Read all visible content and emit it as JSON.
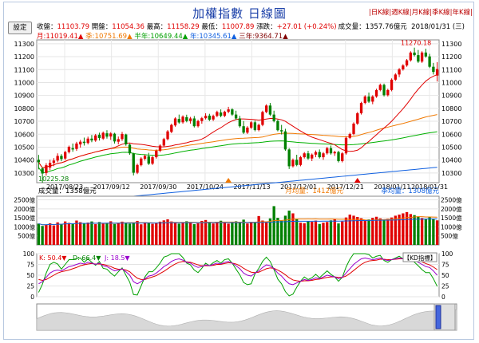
{
  "title": "加權指數  日線圖",
  "nav": {
    "sep": "|",
    "day": "日K線",
    "week": "週K線",
    "month": "月K線",
    "quarter": "季K線",
    "year": "年K線"
  },
  "settings_label": "設定",
  "info": {
    "close_label": "收盤：",
    "close": "11103.79",
    "open_label": "開盤：",
    "open": "11054.36",
    "high_label": "最高：",
    "high": "11158.29",
    "low_label": "最低：",
    "low": "11007.89",
    "chg_label": "漲跌：",
    "chg": "+27.01 (+0.24%)",
    "date": "2018/01/31 (三)",
    "turnover": "成交量：1357.76億元"
  },
  "ma": {
    "m": "月:11019.41▲",
    "q": "季:10751.69▲",
    "h": "半年:10649.44▲",
    "y": "年:10345.61▲",
    "y3": "三年:9364.71▲"
  },
  "colors": {
    "up": "#e00000",
    "down": "#008000",
    "ma_month": "#e00000",
    "ma_quarter": "#f07800",
    "ma_halfyear": "#00b000",
    "ma_year": "#1060e0",
    "k_line": "#9900cc",
    "d_line": "#e00000",
    "j_line": "#00a000"
  },
  "price_panel": {
    "max_label": "11270.18",
    "min_label": "10225.28",
    "y_ticks": [
      "11300",
      "11200",
      "11100",
      "11000",
      "10900",
      "10800",
      "10700",
      "10600",
      "10500",
      "10400",
      "10300"
    ],
    "x_ticks": [
      "2017/08/23",
      "2017/09/12",
      "2017/09/30",
      "2017/10/24",
      "2017/11/13",
      "2017/12/01",
      "2017/12/21",
      "2018/01/11",
      "2018/01/31"
    ]
  },
  "volume_panel": {
    "label": "成交量：1358億元",
    "month_avg": "月均量：1412億元",
    "quarter_avg": "季均量：1308億元",
    "y_ticks": [
      "2500億",
      "2000億",
      "1500億",
      "1000億",
      "500億"
    ]
  },
  "kd_panel": {
    "k": "K: 50.4▼",
    "d": "D: 66.4▼",
    "j": "J: 18.5▼",
    "label": "KD指標",
    "y_ticks": [
      "100",
      "75",
      "50",
      "25",
      "0"
    ]
  },
  "chart_data": {
    "type": "candlestick",
    "candles": [
      [
        10402,
        10440,
        10328,
        10383
      ],
      [
        10335,
        10345,
        10225,
        10296
      ],
      [
        10300,
        10376,
        10280,
        10360
      ],
      [
        10342,
        10402,
        10322,
        10378
      ],
      [
        10378,
        10415,
        10352,
        10396
      ],
      [
        10396,
        10452,
        10383,
        10432
      ],
      [
        10432,
        10446,
        10391,
        10408
      ],
      [
        10412,
        10471,
        10401,
        10462
      ],
      [
        10462,
        10512,
        10451,
        10502
      ],
      [
        10492,
        10528,
        10464,
        10482
      ],
      [
        10486,
        10541,
        10471,
        10528
      ],
      [
        10521,
        10556,
        10496,
        10542
      ],
      [
        10542,
        10574,
        10512,
        10532
      ],
      [
        10532,
        10581,
        10521,
        10566
      ],
      [
        10566,
        10594,
        10538,
        10552
      ],
      [
        10551,
        10602,
        10541,
        10591
      ],
      [
        10596,
        10612,
        10551,
        10571
      ],
      [
        10566,
        10621,
        10556,
        10611
      ],
      [
        10607,
        10631,
        10566,
        10581
      ],
      [
        10582,
        10616,
        10556,
        10606
      ],
      [
        10604,
        10611,
        10528,
        10544
      ],
      [
        10542,
        10582,
        10521,
        10562
      ],
      [
        10562,
        10618,
        10548,
        10602
      ],
      [
        10598,
        10604,
        10511,
        10522
      ],
      [
        10520,
        10526,
        10441,
        10452
      ],
      [
        10450,
        10456,
        10281,
        10302
      ],
      [
        10302,
        10372,
        10291,
        10362
      ],
      [
        10360,
        10422,
        10351,
        10412
      ],
      [
        10410,
        10442,
        10396,
        10432
      ],
      [
        10428,
        10456,
        10362,
        10372
      ],
      [
        10372,
        10432,
        10362,
        10422
      ],
      [
        10422,
        10482,
        10411,
        10472
      ],
      [
        10472,
        10522,
        10461,
        10512
      ],
      [
        10512,
        10572,
        10502,
        10562
      ],
      [
        10562,
        10632,
        10552,
        10622
      ],
      [
        10618,
        10682,
        10608,
        10672
      ],
      [
        10668,
        10731,
        10658,
        10722
      ],
      [
        10718,
        10752,
        10681,
        10691
      ],
      [
        10692,
        10746,
        10681,
        10736
      ],
      [
        10732,
        10751,
        10692,
        10702
      ],
      [
        10702,
        10734,
        10682,
        10722
      ],
      [
        10722,
        10741,
        10652,
        10662
      ],
      [
        10662,
        10712,
        10652,
        10702
      ],
      [
        10702,
        10734,
        10681,
        10724
      ],
      [
        10724,
        10762,
        10714,
        10742
      ],
      [
        10744,
        10758,
        10702,
        10712
      ],
      [
        10714,
        10752,
        10702,
        10742
      ],
      [
        10742,
        10782,
        10732,
        10772
      ],
      [
        10768,
        10792,
        10731,
        10742
      ],
      [
        10742,
        10782,
        10732,
        10774
      ],
      [
        10774,
        10812,
        10762,
        10792
      ],
      [
        10792,
        10801,
        10742,
        10752
      ],
      [
        10752,
        10782,
        10712,
        10722
      ],
      [
        10722,
        10742,
        10651,
        10662
      ],
      [
        10662,
        10702,
        10602,
        10612
      ],
      [
        10612,
        10662,
        10602,
        10651
      ],
      [
        10651,
        10702,
        10641,
        10692
      ],
      [
        10692,
        10706,
        10622,
        10632
      ],
      [
        10632,
        10682,
        10622,
        10672
      ],
      [
        10672,
        10782,
        10662,
        10772
      ],
      [
        10772,
        10832,
        10762,
        10822
      ],
      [
        10822,
        10842,
        10742,
        10752
      ],
      [
        10752,
        10782,
        10692,
        10702
      ],
      [
        10702,
        10712,
        10622,
        10631
      ],
      [
        10631,
        10672,
        10598,
        10622
      ],
      [
        10622,
        10642,
        10472,
        10482
      ],
      [
        10482,
        10492,
        10331,
        10352
      ],
      [
        10352,
        10412,
        10342,
        10402
      ],
      [
        10402,
        10441,
        10352,
        10362
      ],
      [
        10362,
        10432,
        10352,
        10422
      ],
      [
        10422,
        10462,
        10412,
        10452
      ],
      [
        10452,
        10472,
        10402,
        10412
      ],
      [
        10412,
        10451,
        10392,
        10442
      ],
      [
        10442,
        10474,
        10422,
        10462
      ],
      [
        10462,
        10482,
        10412,
        10422
      ],
      [
        10422,
        10462,
        10402,
        10452
      ],
      [
        10452,
        10502,
        10442,
        10492
      ],
      [
        10492,
        10512,
        10442,
        10452
      ],
      [
        10452,
        10472,
        10432,
        10462
      ],
      [
        10462,
        10472,
        10382,
        10392
      ],
      [
        10392,
        10462,
        10382,
        10452
      ],
      [
        10452,
        10582,
        10442,
        10572
      ],
      [
        10572,
        10612,
        10562,
        10602
      ],
      [
        10602,
        10692,
        10592,
        10682
      ],
      [
        10682,
        10772,
        10672,
        10762
      ],
      [
        10762,
        10851,
        10752,
        10842
      ],
      [
        10842,
        10902,
        10832,
        10892
      ],
      [
        10892,
        10922,
        10842,
        10852
      ],
      [
        10852,
        10902,
        10832,
        10892
      ],
      [
        10892,
        10952,
        10882,
        10942
      ],
      [
        10942,
        10992,
        10932,
        10982
      ],
      [
        10982,
        10992,
        10892,
        10902
      ],
      [
        10902,
        10952,
        10892,
        10942
      ],
      [
        10942,
        11032,
        10932,
        11022
      ],
      [
        11022,
        11072,
        11012,
        11062
      ],
      [
        11062,
        11112,
        11042,
        11102
      ],
      [
        11102,
        11142,
        11092,
        11132
      ],
      [
        11132,
        11182,
        11122,
        11172
      ],
      [
        11172,
        11242,
        11162,
        11232
      ],
      [
        11232,
        11270,
        11202,
        11212
      ],
      [
        11212,
        11252,
        11152,
        11162
      ],
      [
        11162,
        11242,
        11152,
        11232
      ],
      [
        11232,
        11262,
        11192,
        11202
      ],
      [
        11202,
        11222,
        11112,
        11122
      ],
      [
        11122,
        11152,
        11062,
        11082
      ],
      [
        11054,
        11158,
        11008,
        11104
      ]
    ],
    "volume": [
      1180,
      1050,
      1120,
      1200,
      1080,
      1250,
      1150,
      1300,
      1220,
      1180,
      1350,
      1260,
      1180,
      1240,
      1300,
      1150,
      1270,
      1180,
      1220,
      1310,
      1160,
      1230,
      1290,
      1210,
      1180,
      1250,
      1330,
      1140,
      1260,
      1200,
      1170,
      1230,
      1290,
      1360,
      1420,
      1300,
      1250,
      1180,
      1220,
      1310,
      1270,
      1150,
      1200,
      1330,
      1380,
      1250,
      1190,
      1260,
      1340,
      1220,
      1180,
      1270,
      1310,
      1250,
      1400,
      1190,
      1280,
      1230,
      1600,
      1350,
      1290,
      1470,
      2150,
      1500,
      1340,
      1620,
      1900,
      1750,
      1450,
      1230,
      1200,
      1320,
      1280,
      1350,
      1160,
      1230,
      1270,
      1360,
      1420,
      1190,
      1300,
      1520,
      1680,
      1620,
      1550,
      1480,
      1350,
      1410,
      1500,
      1560,
      1470,
      1390,
      1450,
      1520,
      1620,
      1680,
      1750,
      1820,
      1710,
      1650,
      1580,
      1490,
      1430,
      1550,
      1420,
      1360
    ],
    "kd_k": [
      30,
      35,
      45,
      55,
      60,
      62,
      60,
      65,
      70,
      72,
      75,
      78,
      76,
      80,
      78,
      75,
      78,
      72,
      70,
      65,
      60,
      62,
      65,
      58,
      50,
      35,
      30,
      35,
      42,
      48,
      50,
      55,
      62,
      70,
      75,
      82,
      86,
      88,
      85,
      80,
      78,
      72,
      68,
      70,
      74,
      72,
      75,
      78,
      76,
      80,
      82,
      78,
      72,
      65,
      55,
      50,
      48,
      55,
      60,
      68,
      74,
      72,
      65,
      55,
      48,
      38,
      30,
      28,
      32,
      36,
      40,
      38,
      40,
      44,
      42,
      46,
      50,
      48,
      46,
      42,
      45,
      55,
      65,
      75,
      82,
      88,
      90,
      88,
      86,
      88,
      90,
      86,
      84,
      86,
      88,
      90,
      88,
      86,
      88,
      84,
      80,
      75,
      70,
      68,
      60,
      50
    ],
    "kd_d": [
      40,
      38,
      40,
      45,
      50,
      55,
      58,
      60,
      62,
      65,
      68,
      72,
      74,
      76,
      77,
      76,
      76,
      75,
      73,
      70,
      66,
      64,
      64,
      62,
      58,
      50,
      43,
      40,
      40,
      43,
      46,
      49,
      54,
      59,
      65,
      71,
      76,
      80,
      82,
      81,
      80,
      77,
      74,
      72,
      72,
      72,
      73,
      75,
      75,
      77,
      79,
      78,
      76,
      72,
      66,
      61,
      57,
      56,
      57,
      61,
      65,
      67,
      66,
      62,
      57,
      51,
      44,
      39,
      37,
      36,
      37,
      37,
      38,
      40,
      41,
      43,
      45,
      46,
      46,
      45,
      45,
      48,
      54,
      61,
      68,
      75,
      80,
      83,
      84,
      85,
      87,
      87,
      86,
      86,
      87,
      88,
      88,
      87,
      87,
      86,
      84,
      81,
      77,
      74,
      69,
      63
    ]
  }
}
